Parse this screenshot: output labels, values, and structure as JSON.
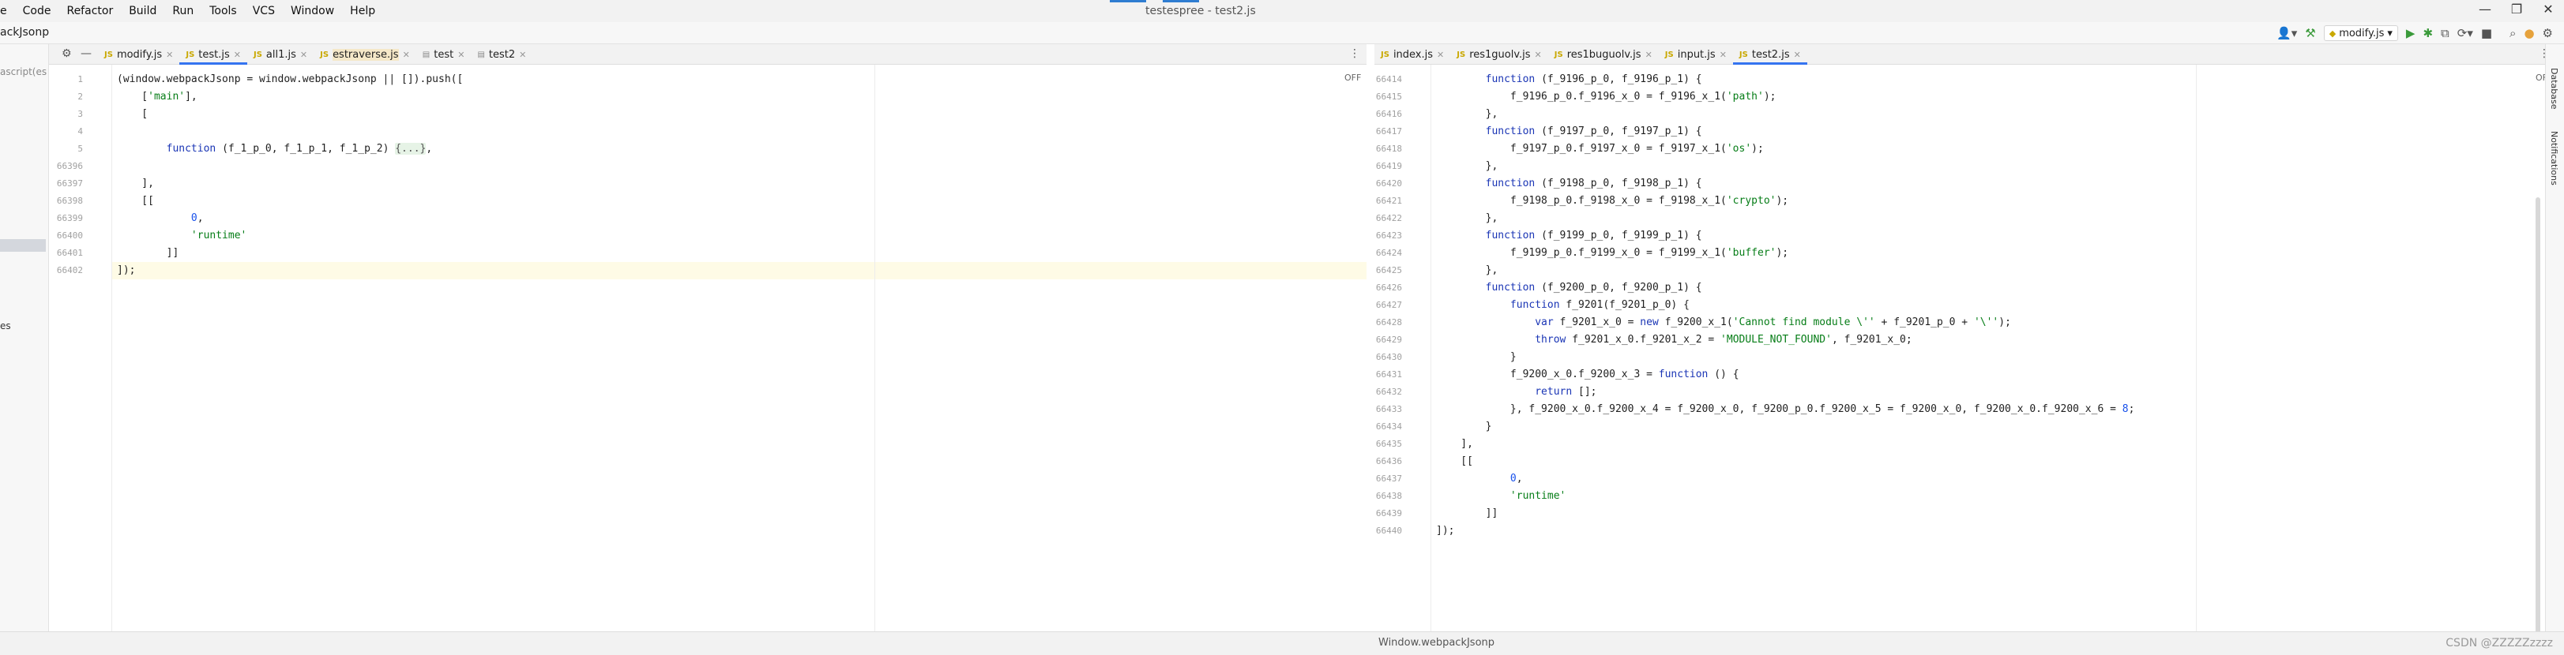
{
  "menubar": {
    "items": [
      "Code",
      "Refactor",
      "Build",
      "Run",
      "Tools",
      "VCS",
      "Window",
      "Help"
    ],
    "first_fragment": "e",
    "title": "testespree - test2.js",
    "minimize": "—",
    "maximize": "❐",
    "close": "✕"
  },
  "navbar": {
    "breadcrumb": "ackJsonp",
    "run_config": "modify.js",
    "run_config_arrow": "▾"
  },
  "leftpanel": {
    "text_top": "ascript(es",
    "text_bottom": "es"
  },
  "left_editor": {
    "tabs": [
      {
        "label": "modify.js",
        "active": false,
        "modified": false
      },
      {
        "label": "test.js",
        "active": true,
        "modified": false
      },
      {
        "label": "all1.js",
        "active": false,
        "modified": false
      },
      {
        "label": "estraverse.js",
        "active": false,
        "modified": true
      },
      {
        "label": "test",
        "active": false,
        "modified": false
      },
      {
        "label": "test2",
        "active": false,
        "modified": false
      }
    ],
    "off_label": "OFF",
    "line_numbers": [
      "1",
      "2",
      "3",
      "4",
      "5",
      "66396",
      "66397",
      "66398",
      "66399",
      "66400",
      "66401",
      "66402"
    ],
    "lines": [
      "(window.webpackJsonp = window.webpackJsonp || []).push([",
      "    ['main'],",
      "    [",
      "",
      "        function (f_1_p_0, f_1_p_1, f_1_p_2) {...},",
      "",
      "    ],",
      "    [[",
      "            0,",
      "            'runtime'",
      "        ]]",
      "]);"
    ]
  },
  "right_editor": {
    "tabs": [
      {
        "label": "index.js",
        "active": false
      },
      {
        "label": "res1guolv.js",
        "active": false
      },
      {
        "label": "res1buguolv.js",
        "active": false
      },
      {
        "label": "input.js",
        "active": false
      },
      {
        "label": "test2.js",
        "active": true
      }
    ],
    "off_label": "OFF",
    "line_numbers": [
      "66414",
      "66415",
      "66416",
      "66417",
      "66418",
      "66419",
      "66420",
      "66421",
      "66422",
      "66423",
      "66424",
      "66425",
      "66426",
      "66427",
      "66428",
      "66429",
      "66430",
      "66431",
      "66432",
      "66433",
      "66434",
      "66435",
      "66436",
      "66437",
      "66438",
      "66439",
      "66440"
    ],
    "lines": [
      "        function (f_9196_p_0, f_9196_p_1) {",
      "            f_9196_p_0.f_9196_x_0 = f_9196_x_1('path');",
      "        },",
      "        function (f_9197_p_0, f_9197_p_1) {",
      "            f_9197_p_0.f_9197_x_0 = f_9197_x_1('os');",
      "        },",
      "        function (f_9198_p_0, f_9198_p_1) {",
      "            f_9198_p_0.f_9198_x_0 = f_9198_x_1('crypto');",
      "        },",
      "        function (f_9199_p_0, f_9199_p_1) {",
      "            f_9199_p_0.f_9199_x_0 = f_9199_x_1('buffer');",
      "        },",
      "        function (f_9200_p_0, f_9200_p_1) {",
      "            function f_9201(f_9201_p_0) {",
      "                var f_9201_x_0 = new f_9200_x_1('Cannot find module \\'' + f_9201_p_0 + '\\'');",
      "                throw f_9201_x_0.f_9201_x_2 = 'MODULE_NOT_FOUND', f_9201_x_0;",
      "            }",
      "            f_9200_x_0.f_9200_x_3 = function () {",
      "                return [];",
      "            }, f_9200_x_0.f_9200_x_4 = f_9200_x_0, f_9200_p_0.f_9200_x_5 = f_9200_x_0, f_9200_x_0.f_9200_x_6 = 8;",
      "        }",
      "    ],",
      "    [[",
      "            0,",
      "            'runtime'",
      "        ]]",
      "]);"
    ]
  },
  "statusbar": {
    "breadcrumb": "Window.webpackJsonp",
    "watermark": "CSDN @ZZZZZzzzz"
  },
  "rightrail": {
    "database": "Database",
    "notifications": "Notifications"
  }
}
